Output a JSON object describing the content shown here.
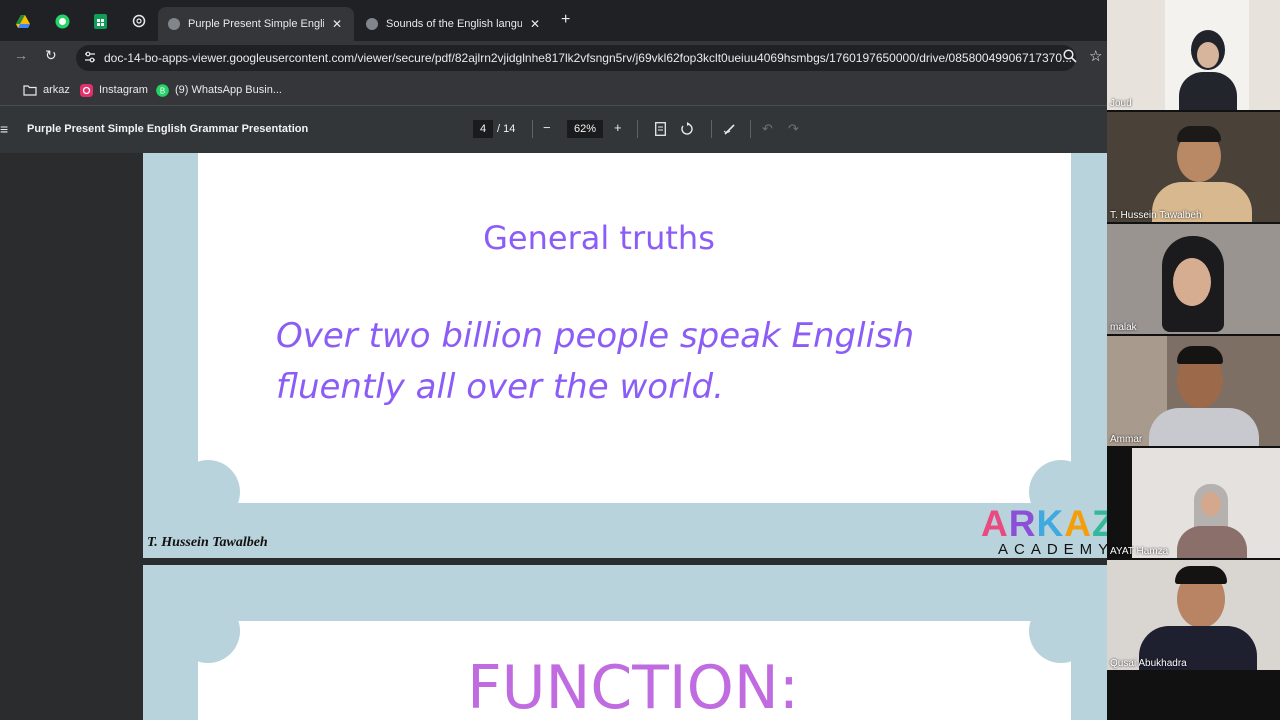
{
  "browser": {
    "tabs": [
      {
        "title": "Purple Present Simple English Grammar Presentation",
        "active": true
      },
      {
        "title": "Sounds of the English language",
        "active": false
      }
    ],
    "new_tab_label": "+",
    "url": "doc-14-bo-apps-viewer.googleusercontent.com/viewer/secure/pdf/82ajlrn2vjidglnhe817lk2vfsngn5rv/j69vkl62fop3kclt0ueiuu4069hsmbgs/1760197650000/drive/08580049906717370..."
  },
  "bookmarks": [
    {
      "label": "arkaz",
      "icon": "folder-icon"
    },
    {
      "label": "Instagram",
      "icon": "instagram-icon"
    },
    {
      "label": "(9) WhatsApp Busin...",
      "icon": "whatsapp-icon"
    }
  ],
  "pdf_toolbar": {
    "menu_icon": "≡",
    "title": "Purple Present Simple English Grammar Presentation",
    "current_page": "4",
    "total_pages": "/ 14",
    "zoom": "62%",
    "minus": "−",
    "plus": "+"
  },
  "slide1": {
    "heading": "General truths",
    "body_line1": "Over two billion people speak English",
    "body_line2": "fluently all over the world.",
    "footer": "T. Hussein Tawalbeh",
    "logo_text": "ARKAZ",
    "logo_sub": "ACADEMY"
  },
  "slide2": {
    "heading": "FUNCTION:"
  },
  "participants": [
    {
      "name": "Joud"
    },
    {
      "name": "T. Hussein Tawalbeh"
    },
    {
      "name": "malak"
    },
    {
      "name": "Ammar"
    },
    {
      "name": "AYAT Hamza"
    },
    {
      "name": "Qusai Abukhadra"
    }
  ],
  "colors": {
    "slide_purple": "#8b5cf6",
    "function_purple": "#c06be0",
    "slide_frame": "#b9d3dc"
  }
}
